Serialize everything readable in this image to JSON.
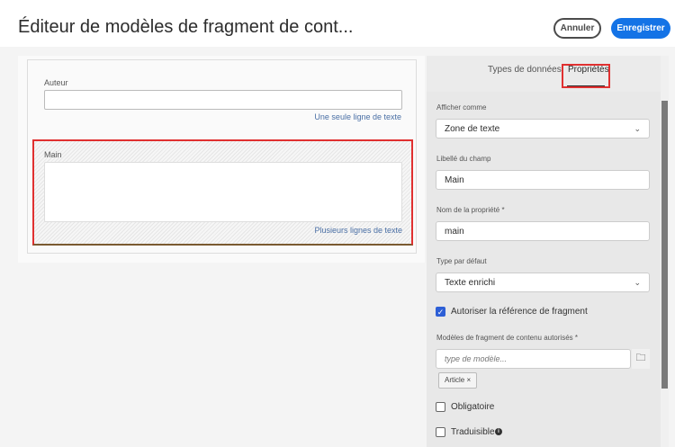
{
  "header": {
    "title": "Éditeur de modèles de fragment de cont...",
    "cancel": "Annuler",
    "save": "Enregistrer"
  },
  "canvas": {
    "fields": [
      {
        "label": "Auteur",
        "hint": "Une seule ligne de texte"
      },
      {
        "label": "Main",
        "hint": "Plusieurs lignes de texte"
      }
    ]
  },
  "panel": {
    "tabs": [
      "Types de données",
      "Propriétés"
    ],
    "display_as": {
      "label": "Afficher comme",
      "value": "Zone de texte"
    },
    "field_label": {
      "label": "Libellé du champ",
      "value": "Main"
    },
    "property_name": {
      "label": "Nom de la propriété *",
      "value": "main"
    },
    "default_type": {
      "label": "Type par défaut",
      "value": "Texte enrichi"
    },
    "allow_fragment_ref": {
      "label": "Autoriser la référence de fragment",
      "checked": true
    },
    "allowed_models": {
      "label": "Modèles de fragment de contenu autorisés *",
      "placeholder": "type de modèle...",
      "tags": [
        "Article"
      ]
    },
    "required": {
      "label": "Obligatoire",
      "checked": false
    },
    "translatable": {
      "label": "Traduisible",
      "checked": false
    }
  }
}
